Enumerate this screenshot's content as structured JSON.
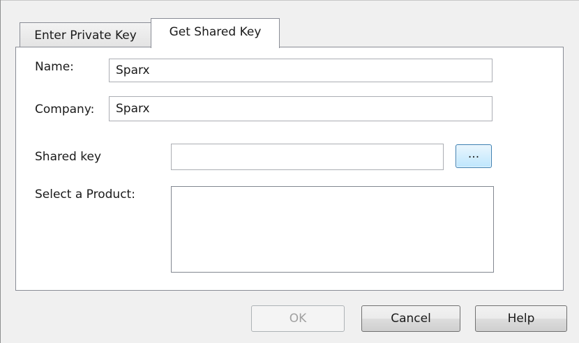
{
  "tabs": [
    {
      "label": "Enter Private Key",
      "active": false
    },
    {
      "label": "Get Shared Key",
      "active": true
    }
  ],
  "form": {
    "name_label": "Name:",
    "name_value": "Sparx",
    "company_label": "Company:",
    "company_value": "Sparx",
    "shared_key_label": "Shared key",
    "shared_key_value": "",
    "browse_label": "...",
    "product_label": "Select a Product:",
    "products": []
  },
  "buttons": {
    "ok": "OK",
    "cancel": "Cancel",
    "help": "Help"
  },
  "colors": {
    "window_bg": "#f0f0f0",
    "panel_bg": "#ffffff",
    "border": "#898c95",
    "browse_hover_border": "#3c7fb1"
  }
}
